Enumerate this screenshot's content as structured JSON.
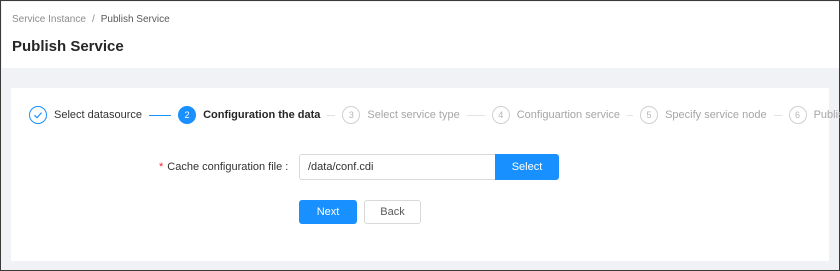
{
  "breadcrumb": {
    "items": [
      "Service Instance",
      "Publish Service"
    ],
    "separator": "/"
  },
  "page": {
    "title": "Publish Service"
  },
  "steps": [
    {
      "number": "",
      "label": "Select datasource",
      "status": "done",
      "icon": "check-icon"
    },
    {
      "number": "2",
      "label": "Configuration the data",
      "status": "active"
    },
    {
      "number": "3",
      "label": "Select service type",
      "status": "wait"
    },
    {
      "number": "4",
      "label": "Configuartion service",
      "status": "wait"
    },
    {
      "number": "5",
      "label": "Specify service node",
      "status": "wait"
    },
    {
      "number": "6",
      "label": "Publish",
      "status": "wait"
    }
  ],
  "form": {
    "required_mark": "*",
    "cache_label": "Cache configuration file :",
    "cache_value": "/data/conf.cdi",
    "select_label": "Select"
  },
  "actions": {
    "next_label": "Next",
    "back_label": "Back"
  },
  "colors": {
    "primary": "#1890ff",
    "required": "#f5222d",
    "page_background": "#f0f2f5"
  }
}
